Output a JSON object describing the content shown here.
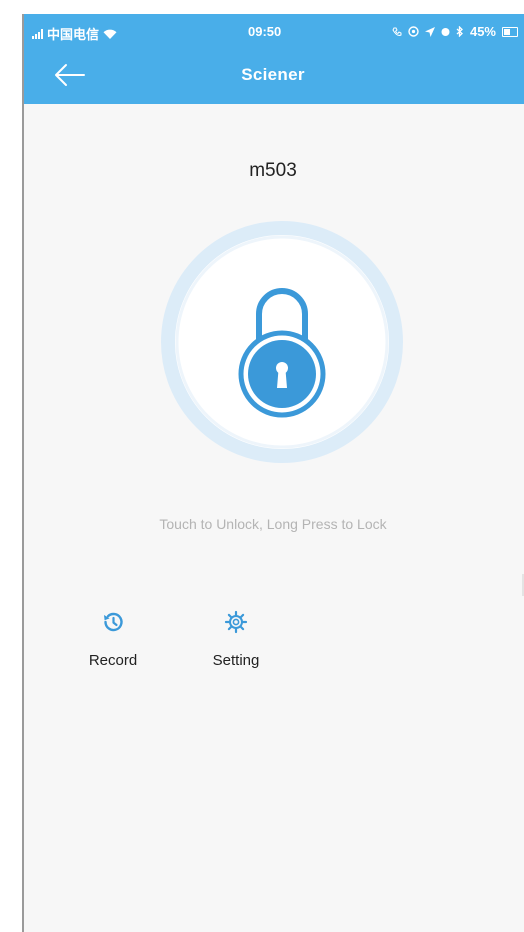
{
  "status_bar": {
    "carrier": "中国电信",
    "time": "09:50",
    "battery": "45%"
  },
  "nav": {
    "title": "Sciener"
  },
  "lock": {
    "name": "m503",
    "hint": "Touch to Unlock, Long Press to Lock"
  },
  "actions": [
    {
      "label": "Record",
      "icon": "history-icon"
    },
    {
      "label": "Setting",
      "icon": "gear-icon"
    }
  ],
  "colors": {
    "accent": "#49aee9",
    "lock_ring": "#dcecf8",
    "lock_icon": "#3b99d9",
    "hint_text": "#b4b4b4"
  }
}
